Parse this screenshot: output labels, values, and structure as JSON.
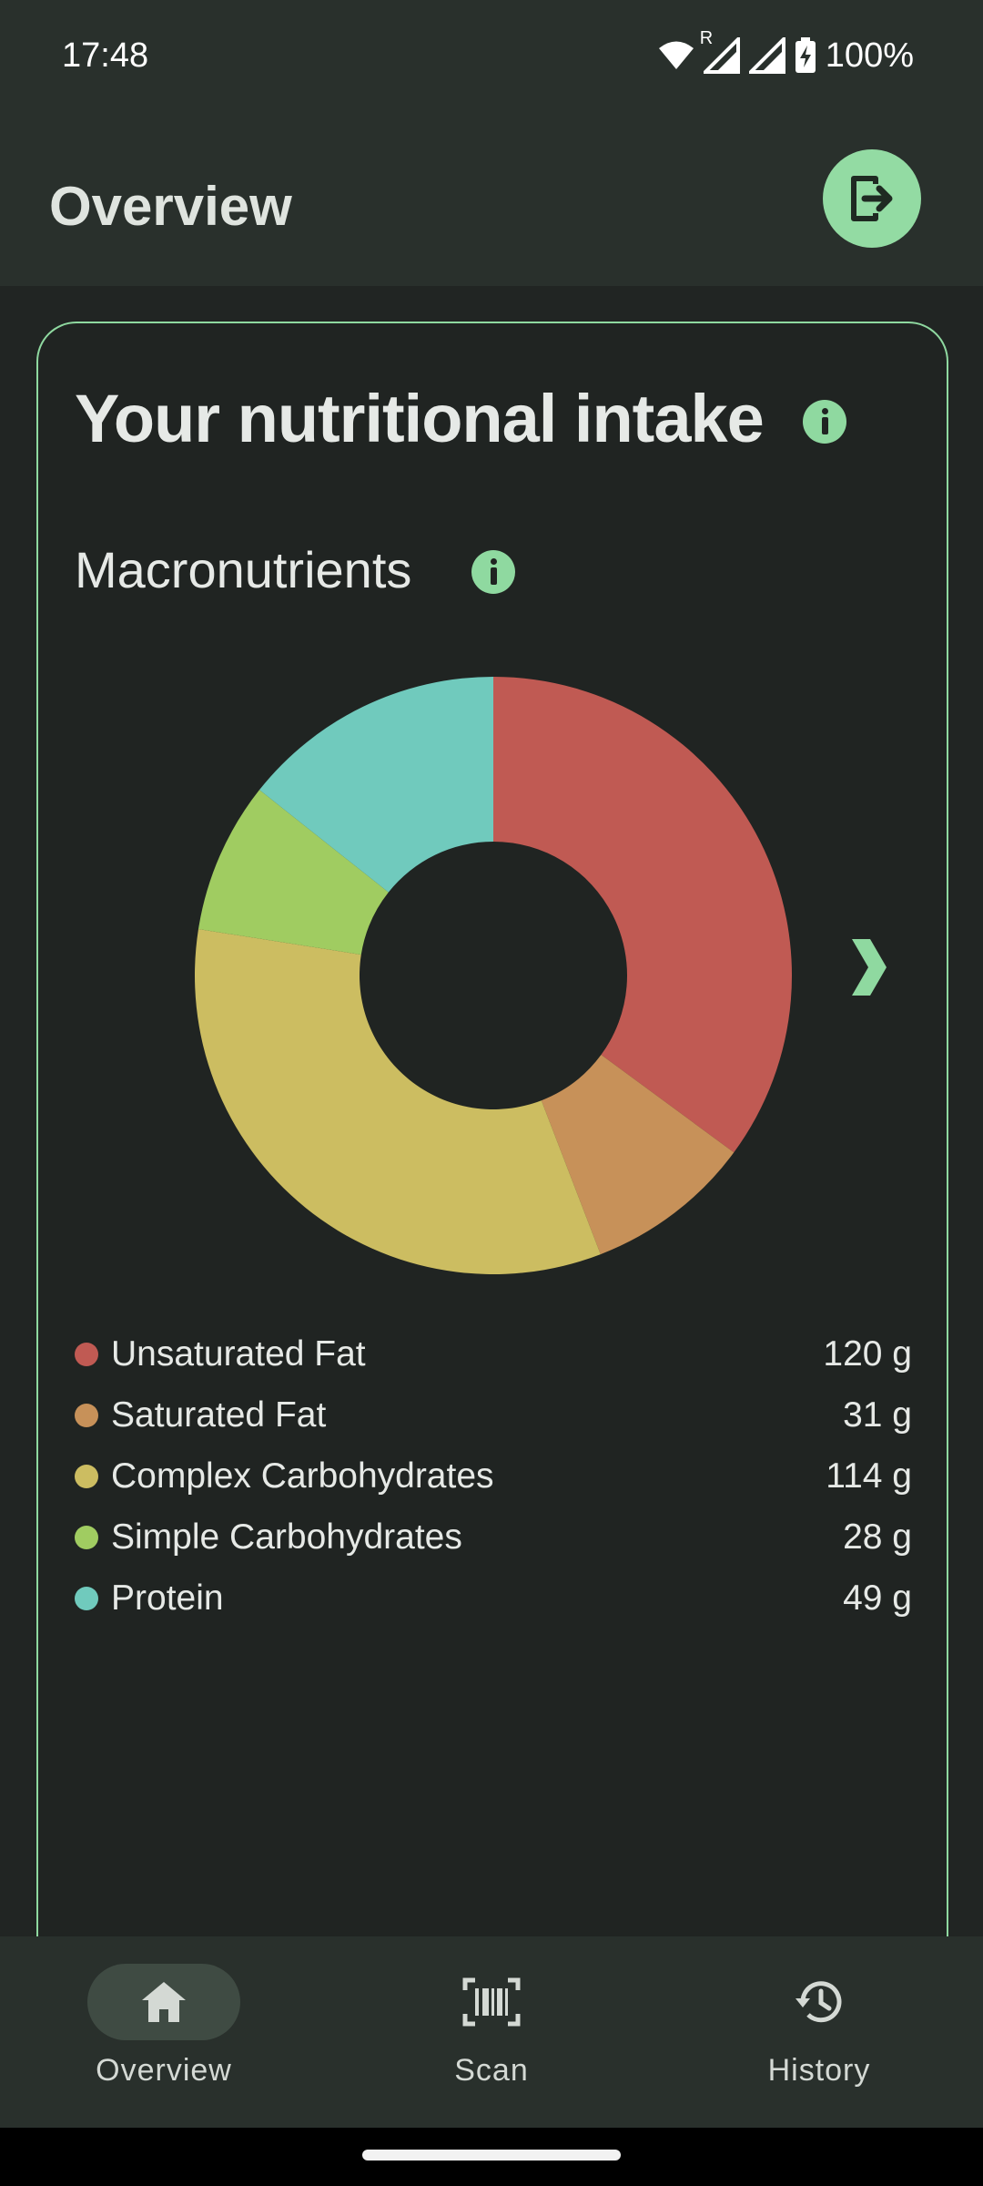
{
  "status_bar": {
    "time": "17:48",
    "roaming_indicator": "R",
    "battery": "100%",
    "icons": [
      "wifi-icon",
      "signal-icon",
      "signal-icon",
      "battery-charging-icon"
    ]
  },
  "header": {
    "title": "Overview",
    "logout_icon": "logout-icon",
    "accent_color": "#93dba3"
  },
  "card": {
    "title": "Your nutritional intake",
    "info_icon": "info-icon",
    "section_title": "Macronutrients",
    "next_icon": "chevron-right-icon"
  },
  "chart_data": {
    "type": "pie",
    "style": "donut",
    "unit": "g",
    "categories": [
      "Unsaturated Fat",
      "Saturated Fat",
      "Complex Carbohydrates",
      "Simple Carbohydrates",
      "Protein"
    ],
    "values": [
      120,
      31,
      114,
      28,
      49
    ],
    "colors": [
      "#c05a53",
      "#c79159",
      "#ccbd61",
      "#a0cc61",
      "#70cabd"
    ]
  },
  "legend": [
    {
      "label": "Unsaturated Fat",
      "value": "120 g",
      "color": "#c05a53"
    },
    {
      "label": "Saturated Fat",
      "value": "31 g",
      "color": "#c79159"
    },
    {
      "label": "Complex Carbohydrates",
      "value": "114 g",
      "color": "#ccbd61"
    },
    {
      "label": "Simple Carbohydrates",
      "value": "28 g",
      "color": "#a0cc61"
    },
    {
      "label": "Protein",
      "value": "49 g",
      "color": "#70cabd"
    }
  ],
  "bottom_nav": {
    "selected": "Overview",
    "items": [
      {
        "label": "Overview",
        "icon": "home-icon"
      },
      {
        "label": "Scan",
        "icon": "barcode-scan-icon"
      },
      {
        "label": "History",
        "icon": "history-icon"
      }
    ]
  }
}
